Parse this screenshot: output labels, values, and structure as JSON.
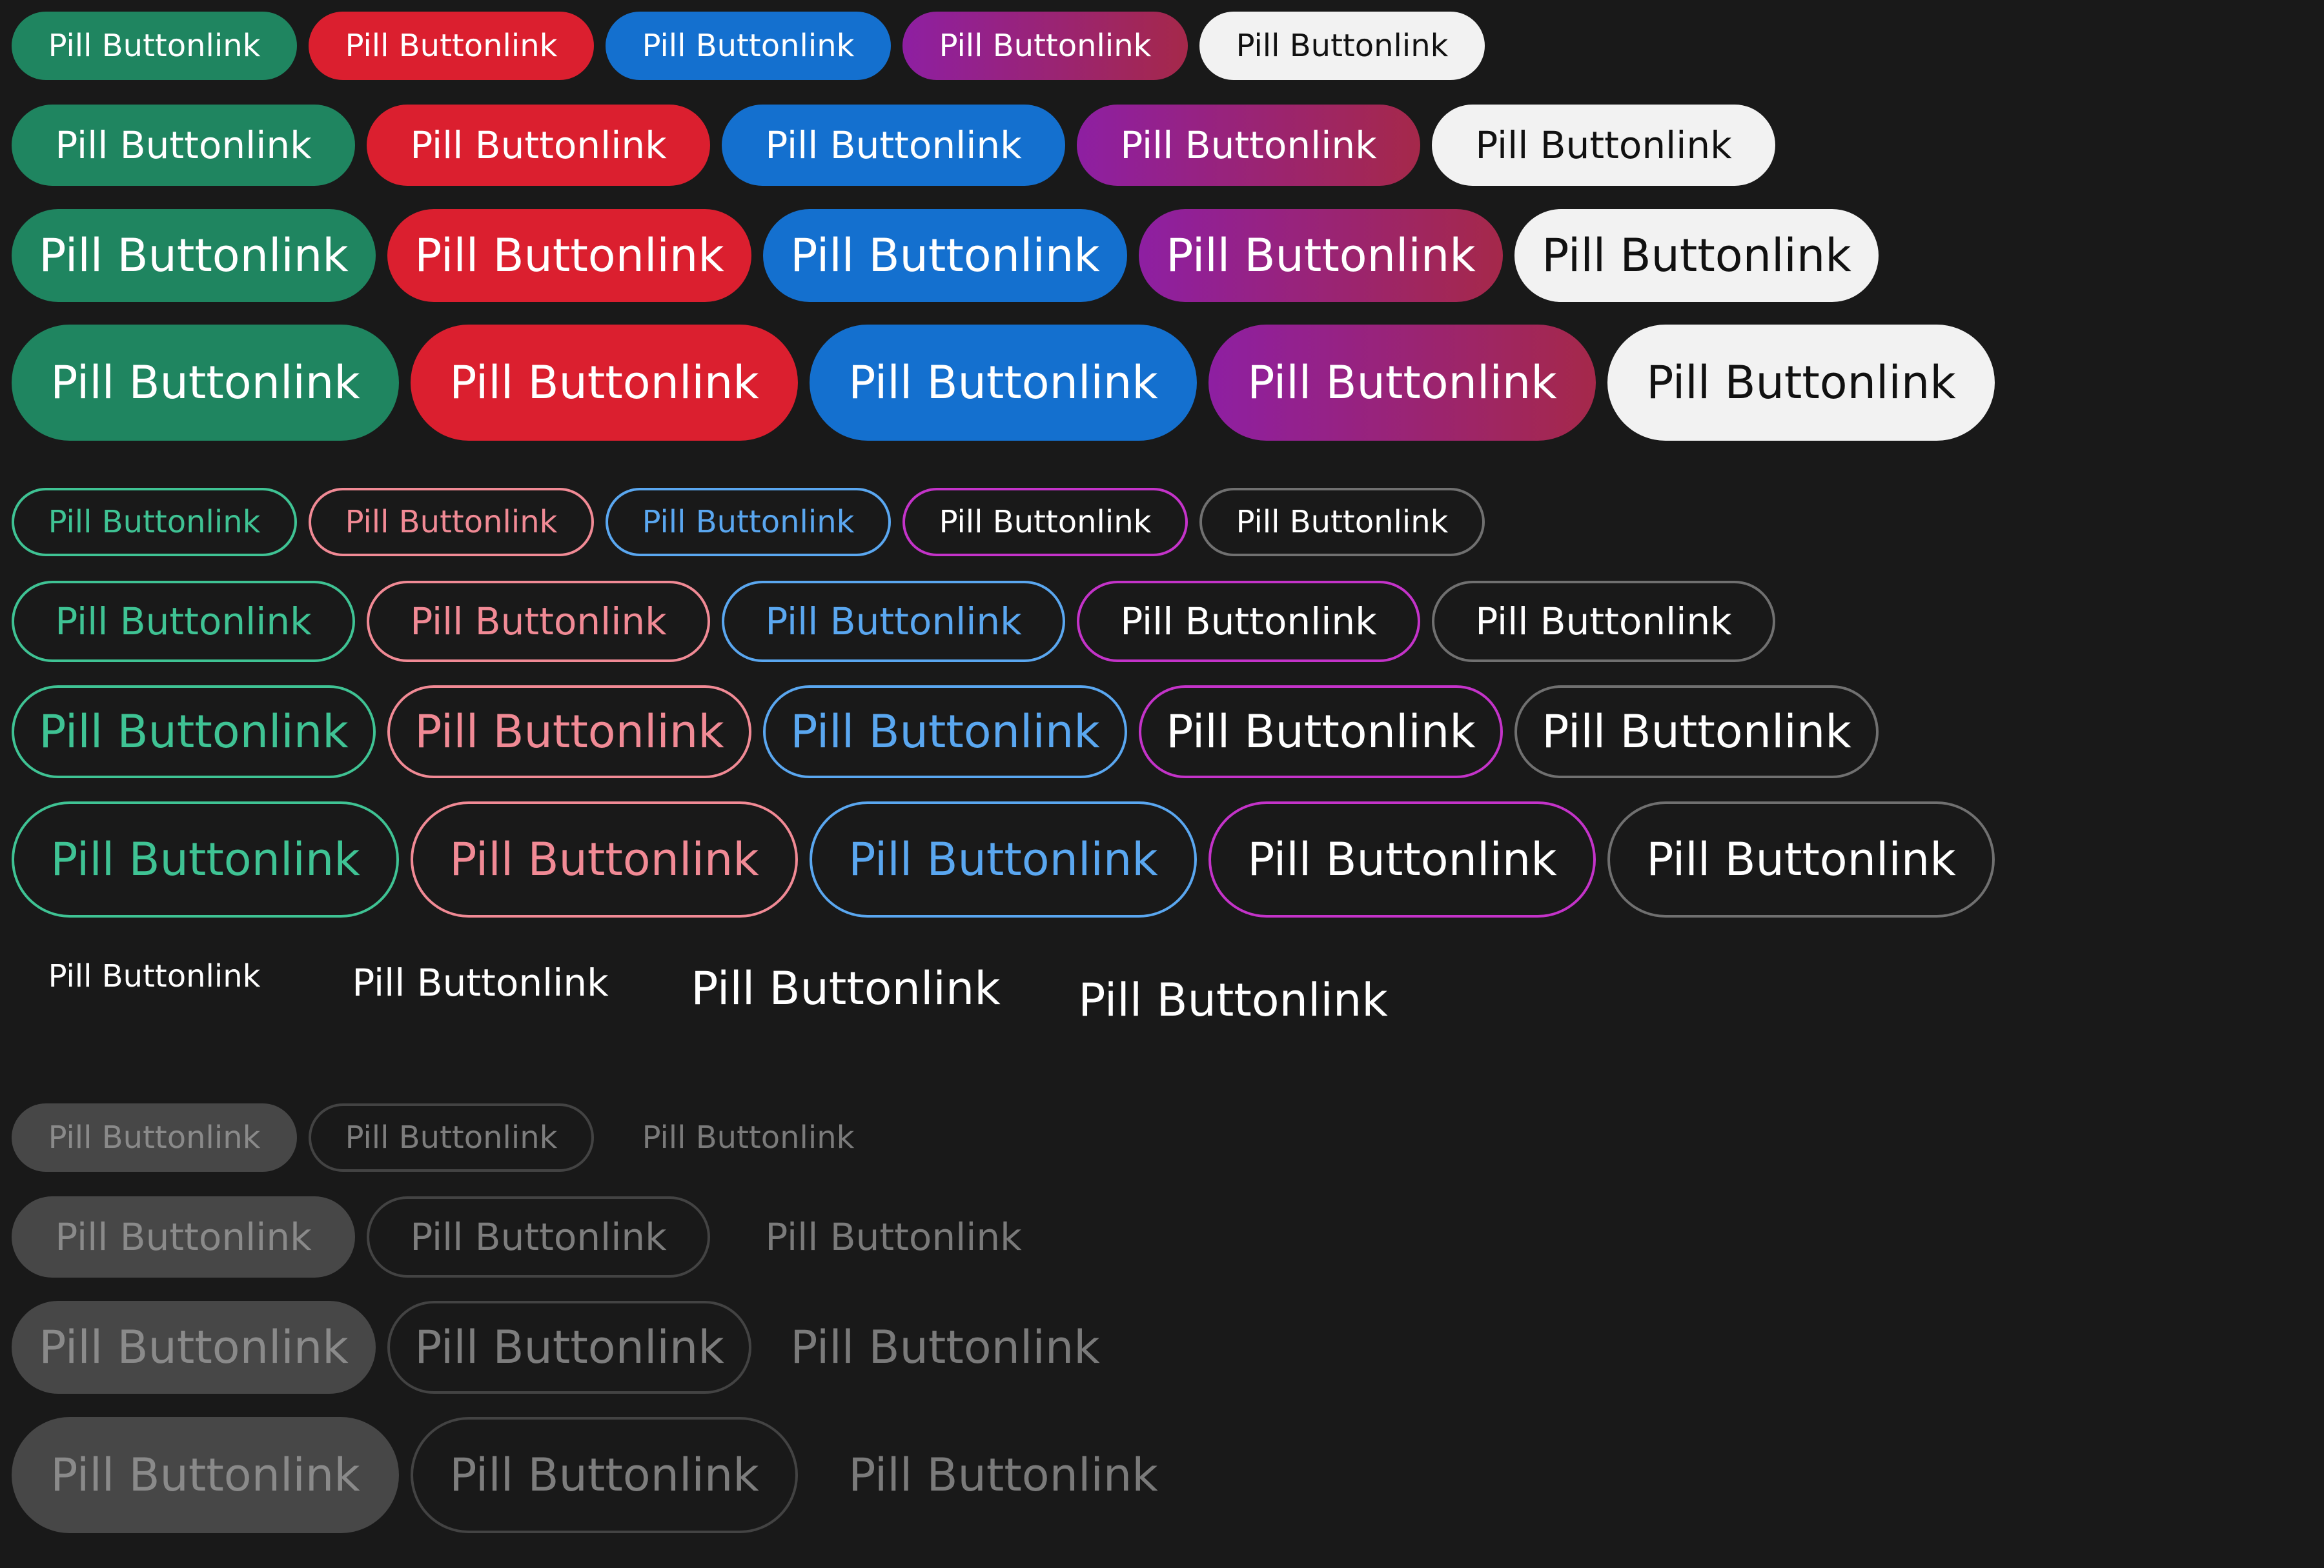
{
  "label": "Pill Buttonlink",
  "variants": {
    "filled": [
      "green",
      "red",
      "blue",
      "purple-gradient",
      "light"
    ],
    "outline": [
      "green",
      "red",
      "blue",
      "purple",
      "grey"
    ],
    "plain": [
      "white"
    ],
    "disabled": [
      "filled",
      "outline",
      "plain"
    ]
  },
  "colors": {
    "background": "#191919",
    "green": "#1f8560",
    "red": "#db1f2f",
    "blue": "#1470cf",
    "purple_gradient_start": "#8e1fa2",
    "purple_gradient_end": "#a5284a",
    "light": "#f2f2f2",
    "outline_green": "#3fc394",
    "outline_red": "#f18a95",
    "outline_blue": "#5aa7f0",
    "outline_purple": "#c433c9",
    "outline_grey": "#707070",
    "disabled_fill": "#474747",
    "disabled_text": "#8a8a8a"
  }
}
